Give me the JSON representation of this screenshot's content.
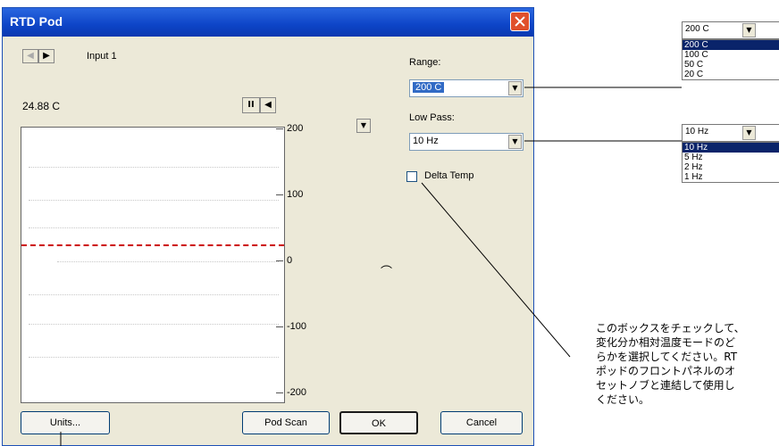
{
  "window": {
    "title": "RTD Pod"
  },
  "nav": {
    "channel_label": "Input 1"
  },
  "readout": {
    "value": "24.88 C"
  },
  "plot": {
    "y_ticks": [
      "200",
      "100",
      "0",
      "-100",
      "-200"
    ],
    "trace_value": 0
  },
  "range": {
    "label": "Range:",
    "value": "200 C"
  },
  "lowpass": {
    "label": "Low Pass:",
    "value": "10 Hz"
  },
  "delta_temp": {
    "label": "Delta Temp",
    "checked": false
  },
  "buttons": {
    "units": "Units...",
    "pod_scan": "Pod Scan",
    "ok": "OK",
    "cancel": "Cancel"
  },
  "range_dropdown": {
    "current": "200 C",
    "options": [
      "200 C",
      "100 C",
      "50 C",
      "20 C"
    ],
    "selected_index": 0
  },
  "lowpass_dropdown": {
    "current": "10 Hz",
    "options": [
      "10 Hz",
      "5 Hz",
      "2 Hz",
      "1 Hz"
    ],
    "selected_index": 0
  },
  "annotation": {
    "text": "このボックスをチェックして、\n変化分か相対温度モードのど\nらかを選択してください。RT\nポッドのフロントパネルのオ\nセットノブと連結して使用し\nください。"
  }
}
